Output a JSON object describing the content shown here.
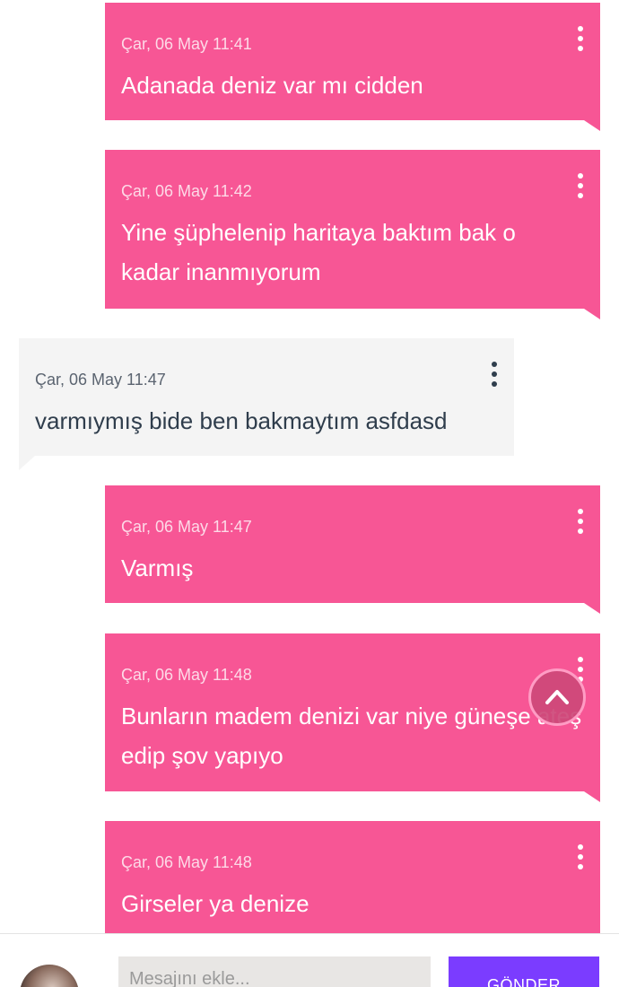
{
  "messages": [
    {
      "side": "mine",
      "time": "Çar, 06 May 11:41",
      "text": "Adanada deniz var mı cidden"
    },
    {
      "side": "mine",
      "time": "Çar, 06 May 11:42",
      "text": "Yine şüphelenip haritaya baktım bak o kadar inanmıyorum"
    },
    {
      "side": "theirs",
      "time": "Çar, 06 May 11:47",
      "text": "varmıymış bide ben bakmaytım asfdasd"
    },
    {
      "side": "mine",
      "time": "Çar, 06 May 11:47",
      "text": "Varmış"
    },
    {
      "side": "mine",
      "time": "Çar, 06 May 11:48",
      "text": "Bunların madem denizi var niye güneşe ateş edip şov yapıyo"
    },
    {
      "side": "mine",
      "time": "Çar, 06 May 11:48",
      "text": "Girseler ya denize"
    }
  ],
  "composer": {
    "placeholder": "Mesajını ekle...",
    "send_label": "GÖNDER"
  },
  "colors": {
    "mine_bubble": "#f75695",
    "theirs_bubble": "#f4f4f4",
    "send_button": "#7b3cff"
  },
  "icons": {
    "message_menu": "more-vertical-icon",
    "scroll_top": "chevron-up-icon"
  }
}
